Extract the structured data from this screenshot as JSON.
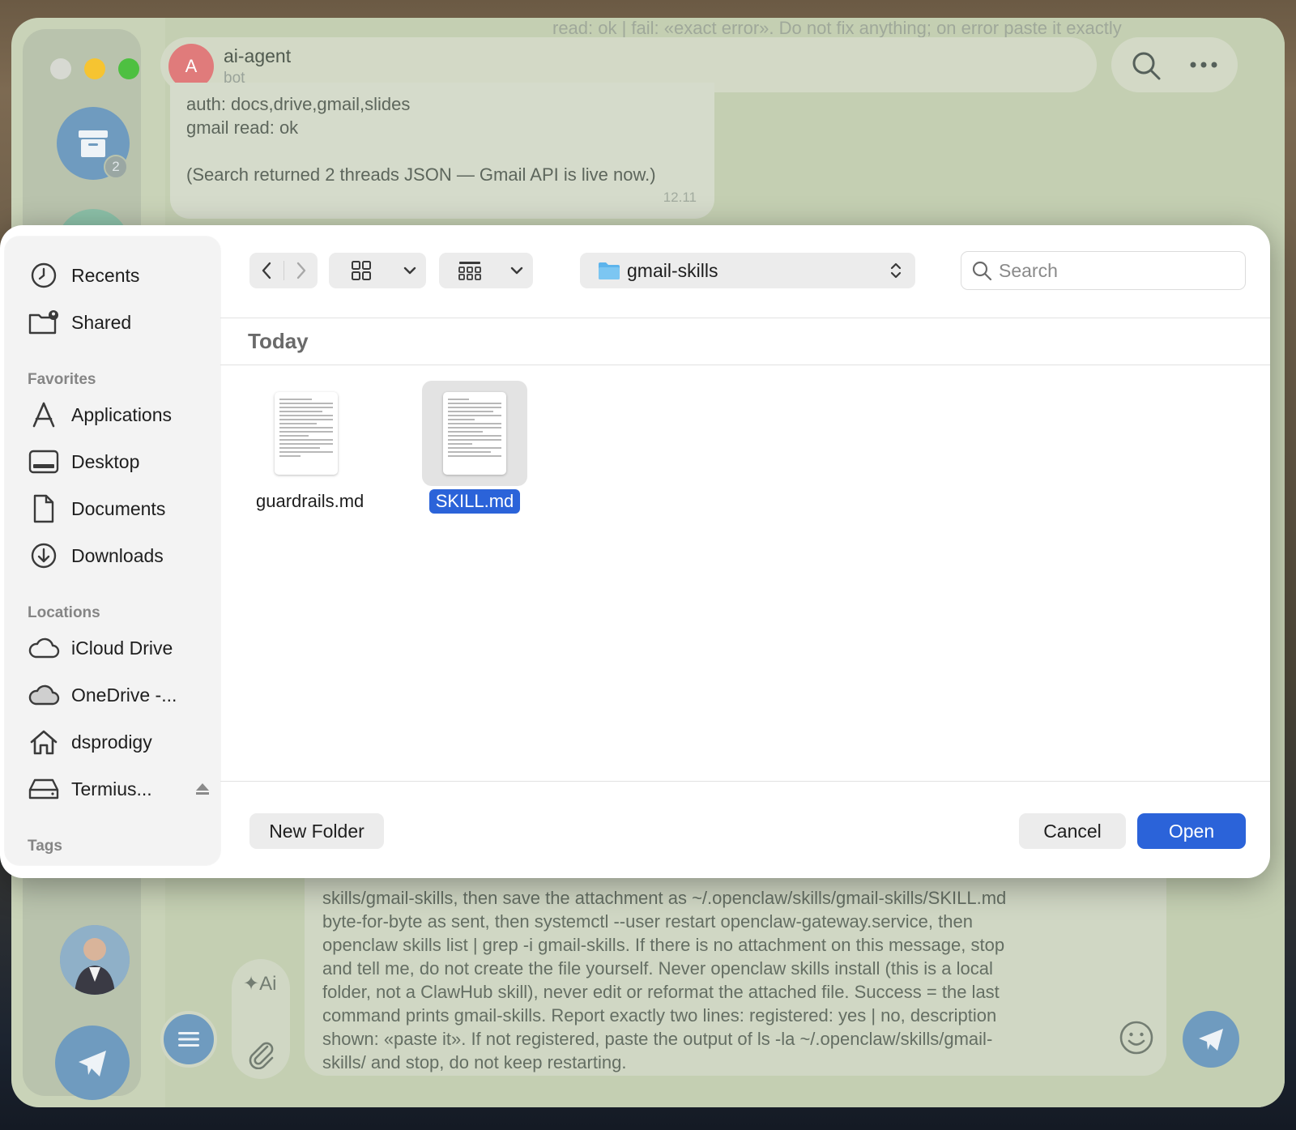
{
  "telegram": {
    "chat": {
      "name": "ai-agent",
      "status": "bot",
      "avatar_letter": "A",
      "pinned_text": "read: ok | fail: «exact error». Do not fix anything; on error paste it exactly"
    },
    "sidebar": {
      "archive_badge": "2"
    },
    "message": {
      "lines": [
        "auth: docs,drive,gmail,slides",
        "gmail read: ok",
        "",
        "(Search returned 2 threads JSON — Gmail API is live now.)"
      ],
      "time": "12.11"
    },
    "composer": {
      "lines": [
        "skills/gmail-skills, then save the attachment as ~/.openclaw/skills/gmail-skills/SKILL.md",
        "byte-for-byte as sent, then systemctl --user restart openclaw-gateway.service, then",
        "openclaw skills list | grep -i gmail-skills. If there is no attachment on this message, stop",
        "and tell me, do not create the file yourself. Never openclaw skills install (this is a local",
        "folder, not a ClawHub skill), never edit or reformat the attached file. Success = the last",
        "command prints gmail-skills. Report exactly two lines: registered: yes | no, description",
        "shown: «paste it». If not registered, paste the output of ls -la ~/.openclaw/skills/gmail-",
        "skills/ and stop, do not keep restarting."
      ]
    }
  },
  "dialog": {
    "sidebar": {
      "top_items": [
        {
          "label": "Recents",
          "icon": "clock-icon"
        },
        {
          "label": "Shared",
          "icon": "shared-folder-icon"
        }
      ],
      "favorites_title": "Favorites",
      "favorites": [
        {
          "label": "Applications",
          "icon": "applications-icon"
        },
        {
          "label": "Desktop",
          "icon": "desktop-icon"
        },
        {
          "label": "Documents",
          "icon": "document-icon"
        },
        {
          "label": "Downloads",
          "icon": "download-icon"
        }
      ],
      "locations_title": "Locations",
      "locations": [
        {
          "label": "iCloud Drive",
          "icon": "cloud-icon"
        },
        {
          "label": "OneDrive -...",
          "icon": "cloud-filled-icon"
        },
        {
          "label": "dsprodigy",
          "icon": "home-icon"
        },
        {
          "label": "Termius...",
          "icon": "drive-icon"
        }
      ],
      "tags_title": "Tags"
    },
    "toolbar": {
      "path": "gmail-skills",
      "search_placeholder": "Search"
    },
    "section_title": "Today",
    "files": [
      {
        "name": "guardrails.md",
        "selected": false
      },
      {
        "name": "SKILL.md",
        "selected": true
      }
    ],
    "buttons": {
      "new_folder": "New Folder",
      "cancel": "Cancel",
      "open": "Open"
    },
    "colors": {
      "accent": "#2b63d9",
      "telegram_blue": "#6f9bbf"
    }
  }
}
